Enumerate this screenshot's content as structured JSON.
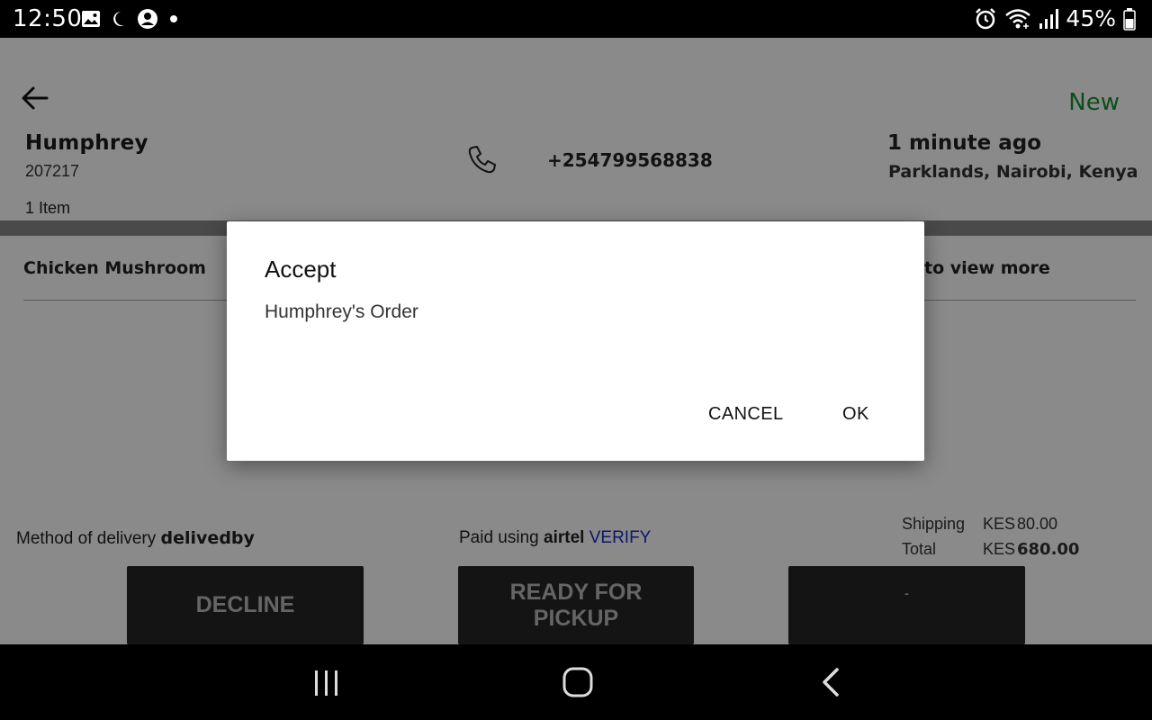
{
  "status_bar": {
    "time": "12:50",
    "battery_percent": "45%",
    "left_icons": [
      "image-icon",
      "moon-icon",
      "account-icon",
      "dot-icon"
    ],
    "right_icons": [
      "alarm-icon",
      "wifi-icon",
      "signal-icon",
      "battery-icon"
    ]
  },
  "order": {
    "status": "New",
    "customer_name": "Humphrey",
    "order_id": "207217",
    "item_count": "1 Item",
    "phone": "+254799568838",
    "time_ago": "1 minute ago",
    "location": "Parklands, Nairobi, Kenya",
    "item_name": "Chicken Mushroom",
    "view_more": "to view more",
    "delivery_label": "Method of delivery",
    "delivery_value": "delivedby",
    "paid_label": "Paid using",
    "paid_method": "airtel",
    "verify_link": "VERIFY",
    "shipping_label": "Shipping",
    "shipping_currency": "KES",
    "shipping_value": "80.00",
    "total_label": "Total",
    "total_currency": "KES",
    "total_value": "680.00"
  },
  "actions": {
    "decline": "DECLINE",
    "ready_line1": "READY FOR",
    "ready_line2": "PICKUP",
    "third": "-"
  },
  "dialog": {
    "title": "Accept",
    "message": "Humphrey's Order",
    "cancel": "CANCEL",
    "ok": "OK"
  },
  "colors": {
    "status_new": "#1b8e2c",
    "verify": "#1a2bbf",
    "button_bg": "#262626"
  }
}
